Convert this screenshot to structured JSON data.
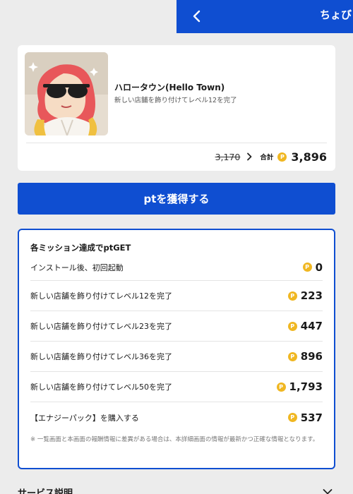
{
  "header": {
    "back_icon": "chevron-left-icon",
    "title": "ちょび"
  },
  "app": {
    "name": "ハロータウン(Hello Town)",
    "description": "新しい店舗を飾り付けてレベル12を完了",
    "old_price": "3,170",
    "total_label": "合計",
    "total": "3,896",
    "coin_symbol": "P"
  },
  "get_button": {
    "label": "ptを獲得する"
  },
  "missions": {
    "title": "各ミッション達成でptGET",
    "items": [
      {
        "label": "インストール後、初回起動",
        "value": "0"
      },
      {
        "label": "新しい店舗を飾り付けてレベル12を完了",
        "value": "223"
      },
      {
        "label": "新しい店舗を飾り付けてレベル23を完了",
        "value": "447"
      },
      {
        "label": "新しい店舗を飾り付けてレベル36を完了",
        "value": "896"
      },
      {
        "label": "新しい店舗を飾り付けてレベル50を完了",
        "value": "1,793"
      },
      {
        "label": "【エナジーパック】を購入する",
        "value": "537"
      }
    ],
    "note": "※ 一覧画面と本画面の報酬情報に差異がある場合は、本詳細画面の情報が最新かつ正確な情報となります。"
  },
  "service": {
    "title": "サービス説明"
  },
  "colors": {
    "accent": "#0f4ed1",
    "coin": "#f0b722",
    "background": "#ececec"
  }
}
